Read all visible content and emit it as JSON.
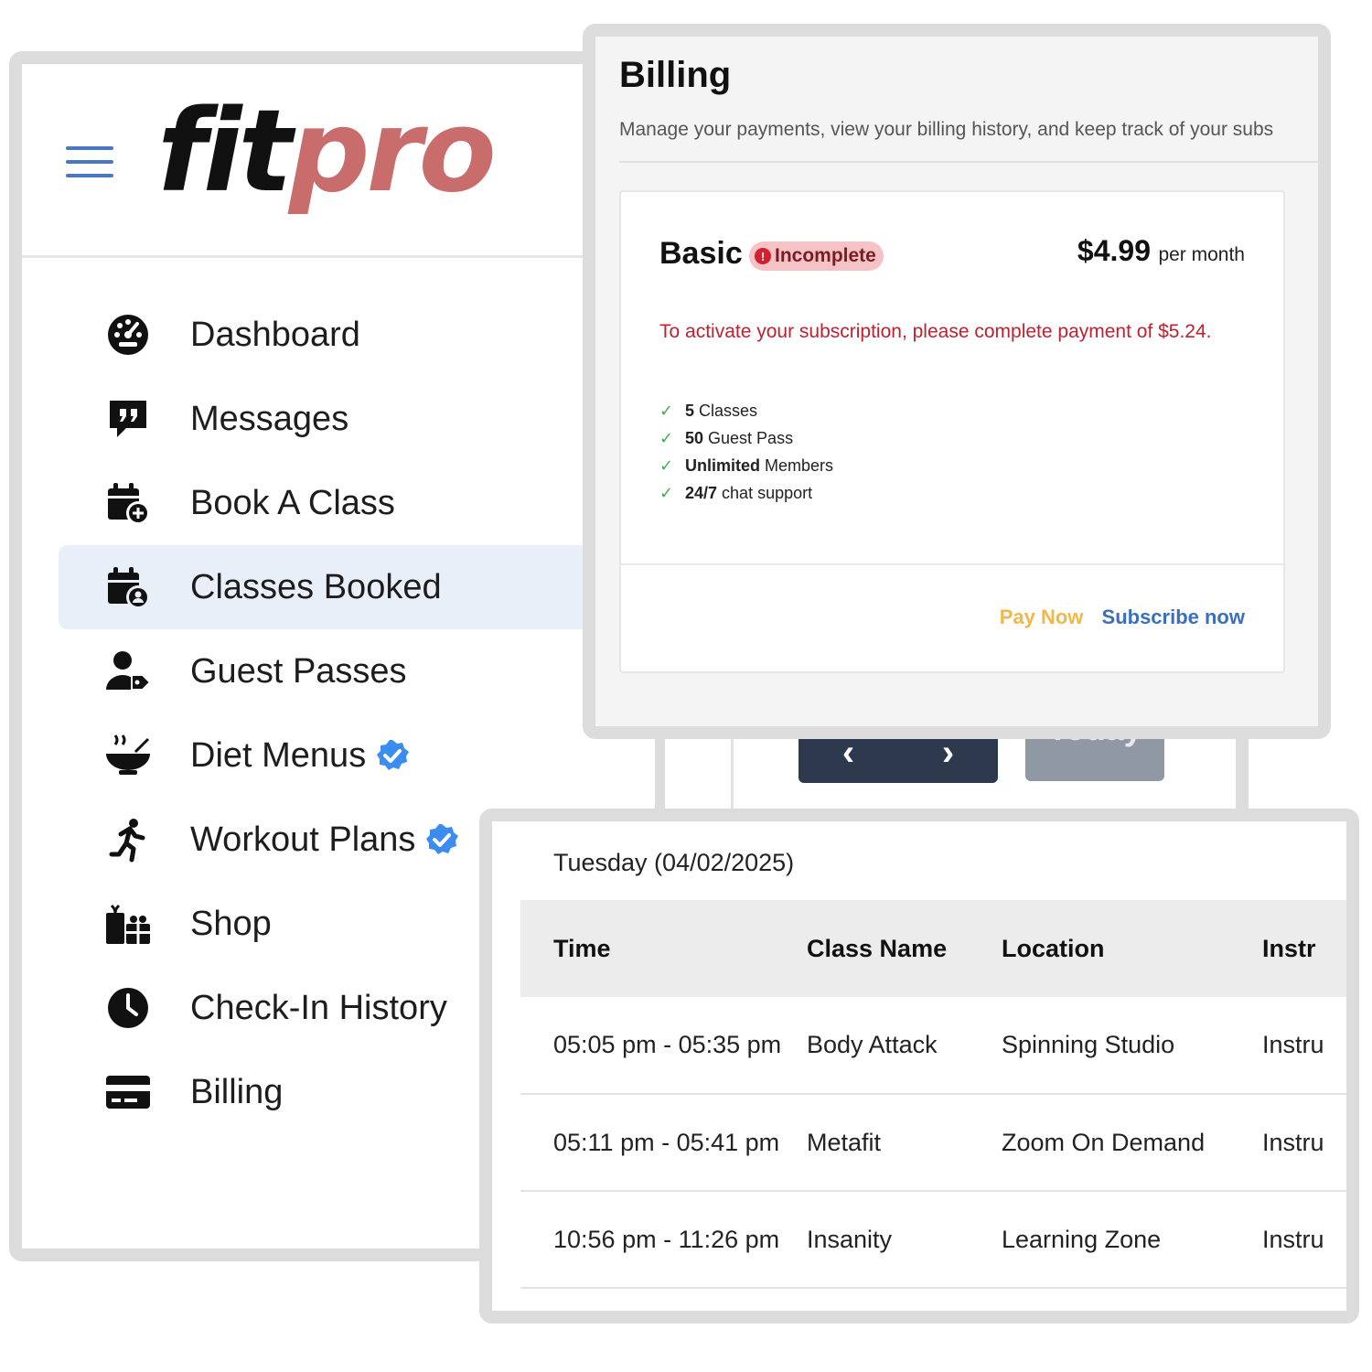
{
  "app": {
    "logo_part1": "fit",
    "logo_part2": "pro",
    "logo_accent_color": "#c96c6c"
  },
  "sidebar": {
    "items": [
      {
        "label": "Dashboard",
        "icon": "dashboard-icon"
      },
      {
        "label": "Messages",
        "icon": "messages-icon"
      },
      {
        "label": "Book A Class",
        "icon": "calendar-plus-icon"
      },
      {
        "label": "Classes Booked",
        "icon": "calendar-user-icon",
        "active": true
      },
      {
        "label": "Guest Passes",
        "icon": "user-tag-icon"
      },
      {
        "label": "Diet Menus",
        "icon": "bowl-icon",
        "verified": true
      },
      {
        "label": "Workout Plans",
        "icon": "running-icon",
        "verified": true
      },
      {
        "label": "Shop",
        "icon": "gifts-icon"
      },
      {
        "label": "Check-In History",
        "icon": "clock-icon"
      },
      {
        "label": "Billing",
        "icon": "credit-card-icon"
      }
    ]
  },
  "calendar": {
    "prev": "‹",
    "next": "›",
    "today_label": "Today"
  },
  "billing": {
    "title": "Billing",
    "subtitle": "Manage your payments, view your billing history, and keep track of your subs",
    "plan": {
      "name": "Basic",
      "status": "Incomplete",
      "price": "$4.99",
      "price_unit": "per month",
      "warning": "To activate your subscription, please complete payment of $5.24.",
      "features": [
        {
          "bold": "5",
          "text": "Classes"
        },
        {
          "bold": "50",
          "text": "Guest Pass"
        },
        {
          "bold": "Unlimited",
          "text": "Members"
        },
        {
          "bold": "24/7",
          "text": "chat support"
        }
      ],
      "pay_now_label": "Pay Now",
      "subscribe_label": "Subscribe now"
    }
  },
  "schedule": {
    "date": "Tuesday (04/02/2025)",
    "columns": [
      "Time",
      "Class Name",
      "Location",
      "Instr"
    ],
    "rows": [
      [
        "05:05 pm - 05:35 pm",
        "Body Attack",
        "Spinning Studio",
        "Instru"
      ],
      [
        "05:11 pm - 05:41 pm",
        "Metafit",
        "Zoom On Demand",
        "Instru"
      ],
      [
        "10:56 pm - 11:26 pm",
        "Insanity",
        "Learning Zone",
        "Instru"
      ]
    ]
  },
  "colors": {
    "accent_blue": "#3a6fc0",
    "active_bg": "#e9eff9",
    "danger": "#c0202f",
    "pay_now": "#f2b74a",
    "verified": "#3b8cf0"
  }
}
